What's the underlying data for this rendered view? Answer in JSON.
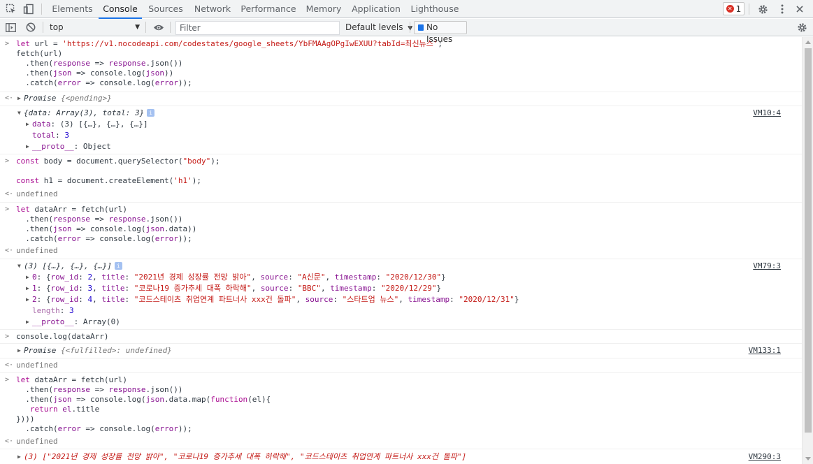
{
  "tabbar": {
    "tabs": [
      "Elements",
      "Console",
      "Sources",
      "Network",
      "Performance",
      "Memory",
      "Application",
      "Lighthouse"
    ],
    "active_tab": "Console",
    "error_count": "1"
  },
  "toolbar": {
    "context": "top",
    "filter_placeholder": "Filter",
    "levels_label": "Default levels",
    "issues_label": "No Issues"
  },
  "console": {
    "e1": {
      "l1a": "let ",
      "l1b": "url",
      "l1c": " = ",
      "l1d": "'https://v1.nocodeapi.com/codestates/google_sheets/YbFMAAgOPgIwEXUU?tabId=최신뉴스'",
      "l1e": ";",
      "l2": "fetch(url)",
      "l3a": "  .then(",
      "l3b": "response",
      "l3c": " => ",
      "l3d": "response",
      "l3e": ".json())",
      "l4a": "  .then(",
      "l4b": "json",
      "l4c": " => ",
      "l4d": "console",
      "l4e": ".log(",
      "l4f": "json",
      "l4g": "))",
      "l5a": "  .catch(",
      "l5b": "error",
      "l5c": " => ",
      "l5d": "console",
      "l5e": ".log(",
      "l5f": "error",
      "l5g": "));"
    },
    "r1": {
      "a": "Promise ",
      "b": "{<pending>}"
    },
    "o1": {
      "head": "{data: Array(3), total: 3}",
      "src": "VM10:4",
      "data_key": "data",
      "data_val": ": (3) [{…}, {…}, {…}]",
      "total_key": "total",
      "total_sep": ": ",
      "total_val": "3",
      "proto_key": "__proto__",
      "proto_val": ": Object"
    },
    "e2": {
      "l1a": "const ",
      "l1b": "body",
      "l1c": " = ",
      "l1d": "document",
      "l1e": ".querySelector(",
      "l1f": "\"body\"",
      "l1g": ");",
      "l2a": "const ",
      "l2b": "h1",
      "l2c": " = ",
      "l2d": "document",
      "l2e": ".createElement(",
      "l2f": "'h1'",
      "l2g": ");"
    },
    "undef": "undefined",
    "e3": {
      "l1a": "let ",
      "l1b": "dataArr",
      "l1c": " = ",
      "l1d": "fetch(url)",
      "l2a": "  .then(",
      "l2b": "response",
      "l2c": " => ",
      "l2d": "response",
      "l2e": ".json())",
      "l3a": "  .then(",
      "l3b": "json",
      "l3c": " => ",
      "l3d": "console",
      "l3e": ".log(",
      "l3f": "json",
      "l3g": ".data))",
      "l4a": "  .catch(",
      "l4b": "error",
      "l4c": " => ",
      "l4d": "console",
      "l4e": ".log(",
      "l4f": "error",
      "l4g": "));"
    },
    "o2": {
      "head": "(3) [{…}, {…}, {…}]",
      "src": "VM79:3",
      "rows": [
        {
          "idx": "0",
          "rid": "2",
          "title": "\"2021년 경제 성장률 전망 밝아\"",
          "source": "\"A신문\"",
          "ts": "\"2020/12/30\""
        },
        {
          "idx": "1",
          "rid": "3",
          "title": "\"코로나19 증가추세 대폭 하락해\"",
          "source": "\"BBC\"",
          "ts": "\"2020/12/29\""
        },
        {
          "idx": "2",
          "rid": "4",
          "title": "\"코드스테이츠 취업연계 파트너사 xxx건 돌파\"",
          "source": "\"스타트업 뉴스\"",
          "ts": "\"2020/12/31\""
        }
      ],
      "length_key": "length",
      "length_val": "3",
      "proto_key": "__proto__",
      "proto_val": ": Array(0)"
    },
    "e4": {
      "line": "console.log(dataArr)"
    },
    "r4": {
      "a": "Promise ",
      "b": "{<fulfilled>: undefined}",
      "src": "VM133:1"
    },
    "e5": {
      "l1a": "let ",
      "l1b": "dataArr",
      "l1c": " = ",
      "l1d": "fetch(url)",
      "l2a": "  .then(",
      "l2b": "response",
      "l2c": " => ",
      "l2d": "response",
      "l2e": ".json())",
      "l3a": "  .then(",
      "l3b": "json",
      "l3c": " => ",
      "l3d": "console",
      "l3e": ".log(",
      "l3f": "json",
      "l3g": ".data.map(",
      "l3h": "function",
      "l3i": "(el){",
      "l4a": "   return ",
      "l4b": "el",
      "l4c": ".title",
      "l5": "})))",
      "l6a": "  .catch(",
      "l6b": "error",
      "l6c": " => ",
      "l6d": "console",
      "l6e": ".log(",
      "l6f": "error",
      "l6g": "));"
    },
    "o3": {
      "head": "(3) [\"2021년 경제 성장률 전망 밝아\", \"코로나19 증가추세 대폭 하락해\", \"코드스테이츠 취업연계 파트너사 xxx건 돌파\"]",
      "src": "VM290:3"
    }
  }
}
